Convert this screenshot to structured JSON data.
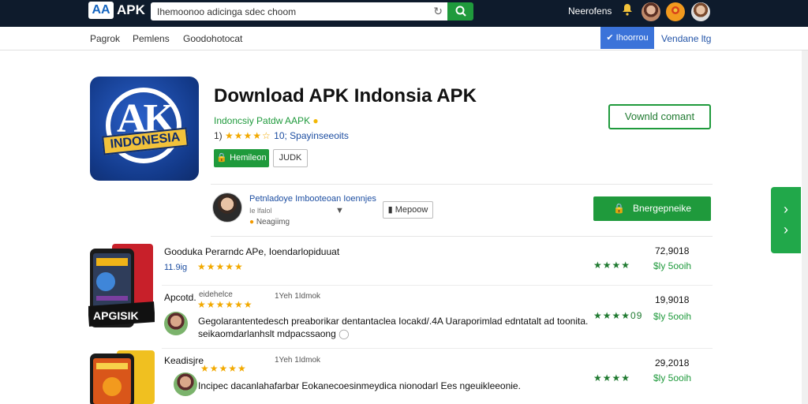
{
  "topbar": {
    "logo_mark": "AA",
    "logo_text": "APK",
    "search_value": "Ihemoonoo adicinga sdec choom",
    "search_icon": "search-icon",
    "reload_icon": "reload-icon",
    "link": "Neerofens"
  },
  "nav": {
    "items": [
      "Pagrok",
      "Pemlens",
      "Goodohotocat"
    ],
    "primary_btn": "Ihoorrou",
    "right_link": "Vendane ltg"
  },
  "app": {
    "icon_ring_text": "AK",
    "icon_banner": "INDONESIA",
    "title": "Download APK Indonsia APK",
    "developer": "Indoncsiy Patdw AAPK",
    "rating_prefix": "1)",
    "stars": "★★★★☆",
    "reviews": "10; Spayinseeoits",
    "btn_green": "Hemileon",
    "btn_outline": "JUDK",
    "download_outline": "Vownld comant"
  },
  "author": {
    "name": "Petnladoye Imbooteoan Ioennjes",
    "sub": "Ie lfalol",
    "tag": "Neagiimg",
    "more_btn": "Mepoow",
    "secure_btn": "Bnergepneike"
  },
  "sidetab": {
    "chevrons": [
      "›",
      "›"
    ]
  },
  "rows": [
    {
      "title": "Gooduka Perarndc APe, Ioendarlopiduuat",
      "size": "11.9ig",
      "stars": "★★★★★",
      "green_stars": "★★★★",
      "number": "72,9018",
      "price": "$ly 5ooih"
    },
    {
      "title": "Apcotd.",
      "meta_top": "eidehelce",
      "stars": "★★★★★★",
      "meta_right": "1Yeh 1Idmok",
      "desc": "Gegolarantentedesch preaborikar dentantaclea Iocakd/.4A Uaraporimlad edntatalt ad toonita.",
      "desc2": "seikaomdarlanhslt mdpacssaong",
      "green_stars": "★★★★09",
      "number": "19,9018",
      "price": "$ly 5ooih"
    },
    {
      "title": "Keadisjre",
      "meta_top": "",
      "stars": "★★★★★",
      "meta_right": "1Yeh 1Idmok",
      "desc": "Incipec dacanlahafarbar Eokanecoesinmeydica nionodarl Ees ngeuikleeonie.",
      "green_stars": "★★★★",
      "number": "29,2018",
      "price": "$ly 5ooih"
    }
  ],
  "phone_banner": "APGISIK",
  "colors": {
    "topbar": "#0e1b2c",
    "accent_green": "#1f9a3c",
    "accent_blue": "#3b73d9",
    "star": "#f2a900"
  }
}
